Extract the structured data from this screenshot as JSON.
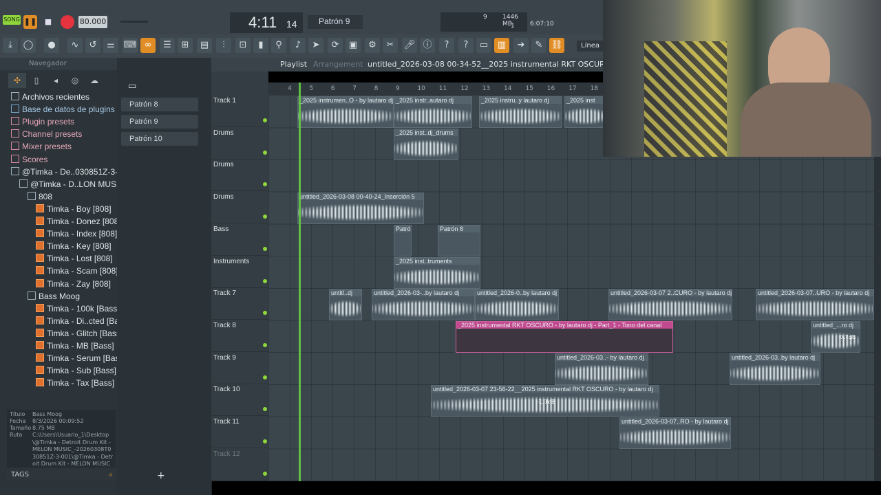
{
  "transport": {
    "mode_label": "SONG",
    "tempo": "80.000",
    "time_main": "4:11",
    "time_sub": "14",
    "pattern": "Patrón 9",
    "cpu_value": "9",
    "mem_value": "1446 MB",
    "poly_value": "1",
    "time_display": "6:07:10"
  },
  "toolbar": {
    "snap_label": "Línea"
  },
  "browser": {
    "header": "Navegador",
    "items": [
      {
        "label": "Archivos recientes",
        "color": "white"
      },
      {
        "label": "Base de datos de plugins",
        "color": "blueish"
      },
      {
        "label": "Plugin presets",
        "color": "pinkish"
      },
      {
        "label": "Channel presets",
        "color": "pinkish"
      },
      {
        "label": "Mixer presets",
        "color": "pinkish"
      },
      {
        "label": "Scores",
        "color": "pinkish"
      },
      {
        "label": "@Timka - De..030851Z-3-001",
        "color": "white"
      },
      {
        "label": "@Timka - D..LON MUSIC_",
        "color": "white"
      },
      {
        "label": "808",
        "color": "white"
      },
      {
        "label": "Timka - Boy [808]",
        "color": "white"
      },
      {
        "label": "Timka - Donez [808]",
        "color": "white"
      },
      {
        "label": "Timka - Index [808]",
        "color": "white"
      },
      {
        "label": "Timka - Key [808]",
        "color": "white"
      },
      {
        "label": "Timka - Lost [808]",
        "color": "white"
      },
      {
        "label": "Timka - Scam [808]",
        "color": "white"
      },
      {
        "label": "Timka - Zay [808]",
        "color": "white"
      },
      {
        "label": "Bass Moog",
        "color": "white"
      },
      {
        "label": "Timka - 100k [Bass]",
        "color": "white"
      },
      {
        "label": "Timka - Di..cted [Bass]",
        "color": "white"
      },
      {
        "label": "Timka - Glitch [Bass]",
        "color": "white"
      },
      {
        "label": "Timka - MB [Bass]",
        "color": "white"
      },
      {
        "label": "Timka - Serum [Bass]",
        "color": "white"
      },
      {
        "label": "Timka - Sub [Bass]",
        "color": "white"
      },
      {
        "label": "Timka - Tax [Bass]",
        "color": "white"
      }
    ],
    "info": {
      "titulo_label": "Título",
      "titulo": "Bass Moog",
      "fecha_label": "Fecha",
      "fecha": "8/3/2026 00:09:52",
      "tamano_label": "Tamaño",
      "tamano": "8.75 MB",
      "ruta_label": "Ruta",
      "ruta": "C:\\Users\\Usuario_1\\Desktop\\@Timka - Detroit Drum Kit - MELON MUSIC_-20260308T030851Z-3-001\\@Timka - Detroit Drum Kit - MELON MUSIC"
    },
    "tags_label": "TAGS"
  },
  "patterns": [
    "Patrón 8",
    "Patrón 9",
    "Patrón 10"
  ],
  "playlist": {
    "title": "Playlist",
    "subtitle": "Arrangement",
    "file": "untitled_2026-03-08 00-34-52__2025 instrumental RKT OSCURO - b",
    "ruler": [
      "4",
      "5",
      "6",
      "7",
      "8",
      "9",
      "10",
      "11",
      "12",
      "13",
      "14",
      "15",
      "16",
      "17",
      "18"
    ],
    "tracks": [
      "Track 1",
      "Drums",
      "Drums",
      "Drums",
      "Bass",
      "Instruments",
      "Track 7",
      "Track 8",
      "Track 9",
      "Track 10",
      "Track 11",
      "Track 12"
    ],
    "clips": [
      {
        "track": 0,
        "label": "_2025 instrumen..O - by lautaro dj"
      },
      {
        "track": 0,
        "label": "_2025 instr..autaro dj"
      },
      {
        "track": 0,
        "label": "_2025 instru..y lautaro dj"
      },
      {
        "track": 0,
        "label": "_2025 inst"
      },
      {
        "track": 1,
        "label": "_2025 inst..dj_drums"
      },
      {
        "track": 3,
        "label": "untitled_2026-03-08 00-40-24_Inserción 5"
      },
      {
        "track": 4,
        "label": "Patrón 8"
      },
      {
        "track": 4,
        "label": "Patrón 8"
      },
      {
        "track": 5,
        "label": "_2025 inst..truments"
      },
      {
        "track": 6,
        "label": "untitl..dj"
      },
      {
        "track": 6,
        "label": "untitled_2026-03-..by lautaro dj"
      },
      {
        "track": 6,
        "label": "untitled_2026-0..by lautaro dj"
      },
      {
        "track": 6,
        "label": "untitled_2026-03-07 2..CURO - by lautaro dj"
      },
      {
        "track": 6,
        "label": "untitled_2026-03-07..URO - by lautaro dj"
      },
      {
        "track": 7,
        "label": "_2025 instrumental RKT OSCURO - by lautaro dj - Part_1 - Tono del canal"
      },
      {
        "track": 7,
        "label": "untitled_...ro dj"
      },
      {
        "track": 8,
        "label": "untitled_2026-03..- by lautaro dj"
      },
      {
        "track": 8,
        "label": "untitled_2026-03..by lautaro dj"
      },
      {
        "track": 9,
        "label": "untitled_2026-03-07 23-56-22__2025 instrumental RKT OSCURO - by lautaro dj"
      },
      {
        "track": 10,
        "label": "untitled_2026-03-07..RO - by lautaro dj"
      }
    ],
    "clip_db_a": "0.7dB",
    "clip_db_b": "-1.3dB"
  },
  "colors": {
    "accent": "#e08d25",
    "green": "#68d445",
    "pink": "#c24b8f"
  }
}
